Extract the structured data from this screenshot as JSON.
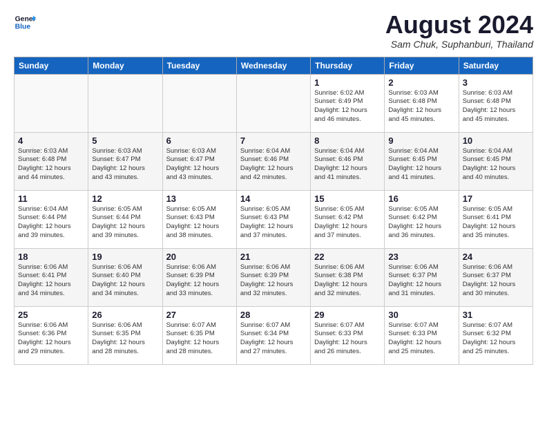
{
  "logo": {
    "line1": "General",
    "line2": "Blue"
  },
  "title": "August 2024",
  "location": "Sam Chuk, Suphanburi, Thailand",
  "days_of_week": [
    "Sunday",
    "Monday",
    "Tuesday",
    "Wednesday",
    "Thursday",
    "Friday",
    "Saturday"
  ],
  "weeks": [
    [
      {
        "day": "",
        "info": ""
      },
      {
        "day": "",
        "info": ""
      },
      {
        "day": "",
        "info": ""
      },
      {
        "day": "",
        "info": ""
      },
      {
        "day": "1",
        "info": "Sunrise: 6:02 AM\nSunset: 6:49 PM\nDaylight: 12 hours\nand 46 minutes."
      },
      {
        "day": "2",
        "info": "Sunrise: 6:03 AM\nSunset: 6:48 PM\nDaylight: 12 hours\nand 45 minutes."
      },
      {
        "day": "3",
        "info": "Sunrise: 6:03 AM\nSunset: 6:48 PM\nDaylight: 12 hours\nand 45 minutes."
      }
    ],
    [
      {
        "day": "4",
        "info": "Sunrise: 6:03 AM\nSunset: 6:48 PM\nDaylight: 12 hours\nand 44 minutes."
      },
      {
        "day": "5",
        "info": "Sunrise: 6:03 AM\nSunset: 6:47 PM\nDaylight: 12 hours\nand 43 minutes."
      },
      {
        "day": "6",
        "info": "Sunrise: 6:03 AM\nSunset: 6:47 PM\nDaylight: 12 hours\nand 43 minutes."
      },
      {
        "day": "7",
        "info": "Sunrise: 6:04 AM\nSunset: 6:46 PM\nDaylight: 12 hours\nand 42 minutes."
      },
      {
        "day": "8",
        "info": "Sunrise: 6:04 AM\nSunset: 6:46 PM\nDaylight: 12 hours\nand 41 minutes."
      },
      {
        "day": "9",
        "info": "Sunrise: 6:04 AM\nSunset: 6:45 PM\nDaylight: 12 hours\nand 41 minutes."
      },
      {
        "day": "10",
        "info": "Sunrise: 6:04 AM\nSunset: 6:45 PM\nDaylight: 12 hours\nand 40 minutes."
      }
    ],
    [
      {
        "day": "11",
        "info": "Sunrise: 6:04 AM\nSunset: 6:44 PM\nDaylight: 12 hours\nand 39 minutes."
      },
      {
        "day": "12",
        "info": "Sunrise: 6:05 AM\nSunset: 6:44 PM\nDaylight: 12 hours\nand 39 minutes."
      },
      {
        "day": "13",
        "info": "Sunrise: 6:05 AM\nSunset: 6:43 PM\nDaylight: 12 hours\nand 38 minutes."
      },
      {
        "day": "14",
        "info": "Sunrise: 6:05 AM\nSunset: 6:43 PM\nDaylight: 12 hours\nand 37 minutes."
      },
      {
        "day": "15",
        "info": "Sunrise: 6:05 AM\nSunset: 6:42 PM\nDaylight: 12 hours\nand 37 minutes."
      },
      {
        "day": "16",
        "info": "Sunrise: 6:05 AM\nSunset: 6:42 PM\nDaylight: 12 hours\nand 36 minutes."
      },
      {
        "day": "17",
        "info": "Sunrise: 6:05 AM\nSunset: 6:41 PM\nDaylight: 12 hours\nand 35 minutes."
      }
    ],
    [
      {
        "day": "18",
        "info": "Sunrise: 6:06 AM\nSunset: 6:41 PM\nDaylight: 12 hours\nand 34 minutes."
      },
      {
        "day": "19",
        "info": "Sunrise: 6:06 AM\nSunset: 6:40 PM\nDaylight: 12 hours\nand 34 minutes."
      },
      {
        "day": "20",
        "info": "Sunrise: 6:06 AM\nSunset: 6:39 PM\nDaylight: 12 hours\nand 33 minutes."
      },
      {
        "day": "21",
        "info": "Sunrise: 6:06 AM\nSunset: 6:39 PM\nDaylight: 12 hours\nand 32 minutes."
      },
      {
        "day": "22",
        "info": "Sunrise: 6:06 AM\nSunset: 6:38 PM\nDaylight: 12 hours\nand 32 minutes."
      },
      {
        "day": "23",
        "info": "Sunrise: 6:06 AM\nSunset: 6:37 PM\nDaylight: 12 hours\nand 31 minutes."
      },
      {
        "day": "24",
        "info": "Sunrise: 6:06 AM\nSunset: 6:37 PM\nDaylight: 12 hours\nand 30 minutes."
      }
    ],
    [
      {
        "day": "25",
        "info": "Sunrise: 6:06 AM\nSunset: 6:36 PM\nDaylight: 12 hours\nand 29 minutes."
      },
      {
        "day": "26",
        "info": "Sunrise: 6:06 AM\nSunset: 6:35 PM\nDaylight: 12 hours\nand 28 minutes."
      },
      {
        "day": "27",
        "info": "Sunrise: 6:07 AM\nSunset: 6:35 PM\nDaylight: 12 hours\nand 28 minutes."
      },
      {
        "day": "28",
        "info": "Sunrise: 6:07 AM\nSunset: 6:34 PM\nDaylight: 12 hours\nand 27 minutes."
      },
      {
        "day": "29",
        "info": "Sunrise: 6:07 AM\nSunset: 6:33 PM\nDaylight: 12 hours\nand 26 minutes."
      },
      {
        "day": "30",
        "info": "Sunrise: 6:07 AM\nSunset: 6:33 PM\nDaylight: 12 hours\nand 25 minutes."
      },
      {
        "day": "31",
        "info": "Sunrise: 6:07 AM\nSunset: 6:32 PM\nDaylight: 12 hours\nand 25 minutes."
      }
    ]
  ]
}
